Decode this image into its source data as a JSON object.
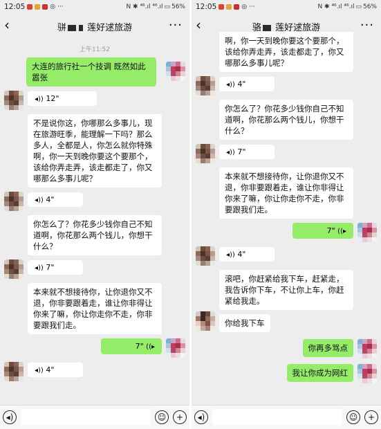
{
  "status": {
    "time": "12:05",
    "battery": "56%",
    "icons": "N ✱ ⁴⁶.ıl ⁴⁶.ıl"
  },
  "chat": {
    "title_left": "骈",
    "title_right": "莲好逑旅游",
    "title_right_b_prefix": "骆",
    "title_right_b": "莲好逑旅游",
    "more_label": "···",
    "back_label": "‹",
    "timestamp": "上午11:52"
  },
  "left_messages": {
    "m1": "大连的旅行社一个技调 既然如此嚣张",
    "v1": "12\"",
    "m2": "不是说你这，你哪那么多事儿，现在旅游旺季，能理解一下吗？那么多人，全都是人，你怎么就你特殊啊，你一天到晚你要这个要那个，该给你弄走弄，该走都走了，你又哪那么多事儿呢？",
    "v2": "4\"",
    "m3": "你怎么了？你花多少钱你自己不知道啊，你花那么两个钱儿，你想干什么？",
    "v3": "7\"",
    "m4": "本来就不想接待你，让你退你又不退，你非要跟着走，谁让你非得让你来了嘛，你让你走你不走，你非要跟我们走。",
    "v4": "7\"",
    "v5": "4\""
  },
  "right_messages": {
    "m0": "啊，你一天到晚你要这个要那个，该给你弄走弄，该走都走了，你又哪那么多事儿呢？",
    "v1": "4\"",
    "m1": "你怎么了？你花多少钱你自己不知道啊，你花那么两个钱儿，你想干什么？",
    "v2": "7\"",
    "m2": "本来就不想接待你，让你退你又不退，你非要跟着走，谁让你非得让你来了嘛，你让你走你不走，你非要跟我们走。",
    "v3": "7\"",
    "v4": "4\"",
    "m3": "滚吧，你赶紧给我下车，赶紧走，我告诉你下车，不让你上车，你赶紧给我走。",
    "m4": "你给我下车",
    "m5": "你再多骂点",
    "m6": "我让你成为网红"
  },
  "icons": {
    "voice_input": "voice-icon",
    "emoji": "emoji-icon",
    "plus": "plus-icon"
  },
  "colors": {
    "background": "#ededed",
    "outgoing": "#95ec69",
    "incoming": "#ffffff"
  }
}
